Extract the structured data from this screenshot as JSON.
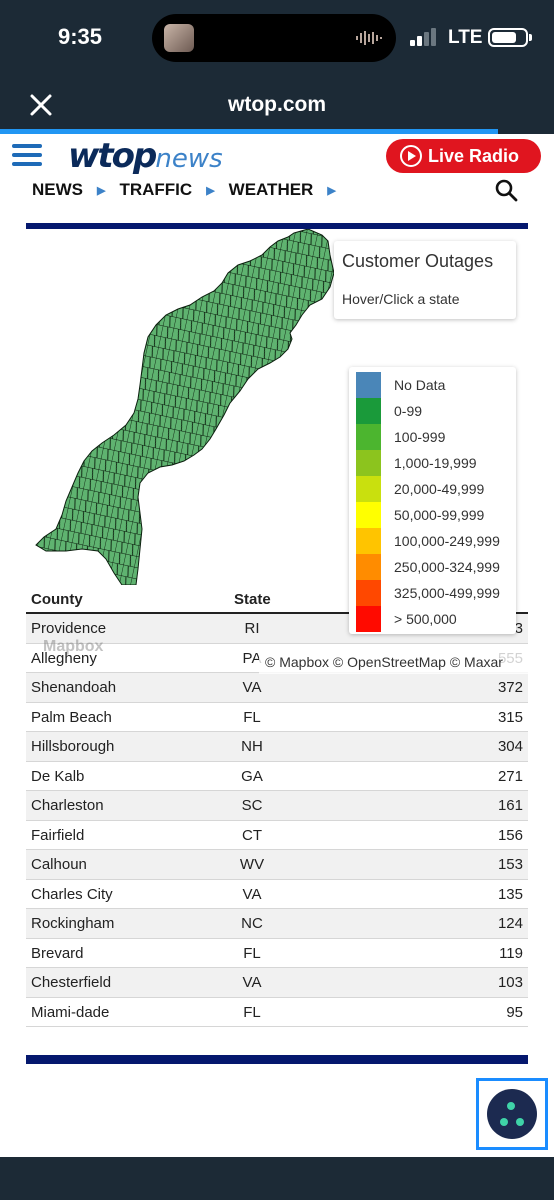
{
  "status_bar": {
    "time": "9:35",
    "network": "LTE"
  },
  "browser": {
    "url": "wtop.com"
  },
  "header": {
    "logo_primary": "wtop",
    "logo_secondary": "news",
    "live_radio": "Live Radio",
    "nav": [
      "NEWS",
      "TRAFFIC",
      "WEATHER"
    ]
  },
  "map": {
    "card_title": "Customer Outages",
    "card_subtitle": "Hover/Click a state",
    "attribution": "© Mapbox © OpenStreetMap © Maxar",
    "mapbox_mark": "Mapbox",
    "legend": [
      {
        "label": "No Data",
        "color": "#4a86b8"
      },
      {
        "label": "0-99",
        "color": "#1a9a3a"
      },
      {
        "label": "100-999",
        "color": "#4cb52f"
      },
      {
        "label": "1,000-19,999",
        "color": "#8cc41e"
      },
      {
        "label": "20,000-49,999",
        "color": "#c9e00e"
      },
      {
        "label": "50,000-99,999",
        "color": "#ffff00"
      },
      {
        "label": "100,000-249,999",
        "color": "#ffc400"
      },
      {
        "label": "250,000-324,999",
        "color": "#ff8c00"
      },
      {
        "label": "325,000-499,999",
        "color": "#ff4800"
      },
      {
        "label": "> 500,000",
        "color": "#ff0a00"
      }
    ]
  },
  "table": {
    "headers": [
      "County",
      "State"
    ],
    "rows": [
      {
        "county": "Providence",
        "state": "RI",
        "outages": "3"
      },
      {
        "county": "Allegheny",
        "state": "PA",
        "outages": "555"
      },
      {
        "county": "Shenandoah",
        "state": "VA",
        "outages": "372"
      },
      {
        "county": "Palm Beach",
        "state": "FL",
        "outages": "315"
      },
      {
        "county": "Hillsborough",
        "state": "NH",
        "outages": "304"
      },
      {
        "county": "De Kalb",
        "state": "GA",
        "outages": "271"
      },
      {
        "county": "Charleston",
        "state": "SC",
        "outages": "161"
      },
      {
        "county": "Fairfield",
        "state": "CT",
        "outages": "156"
      },
      {
        "county": "Calhoun",
        "state": "WV",
        "outages": "153"
      },
      {
        "county": "Charles City",
        "state": "VA",
        "outages": "135"
      },
      {
        "county": "Rockingham",
        "state": "NC",
        "outages": "124"
      },
      {
        "county": "Brevard",
        "state": "FL",
        "outages": "119"
      },
      {
        "county": "Chesterfield",
        "state": "VA",
        "outages": "103"
      },
      {
        "county": "Miami-dade",
        "state": "FL",
        "outages": "95"
      }
    ]
  }
}
